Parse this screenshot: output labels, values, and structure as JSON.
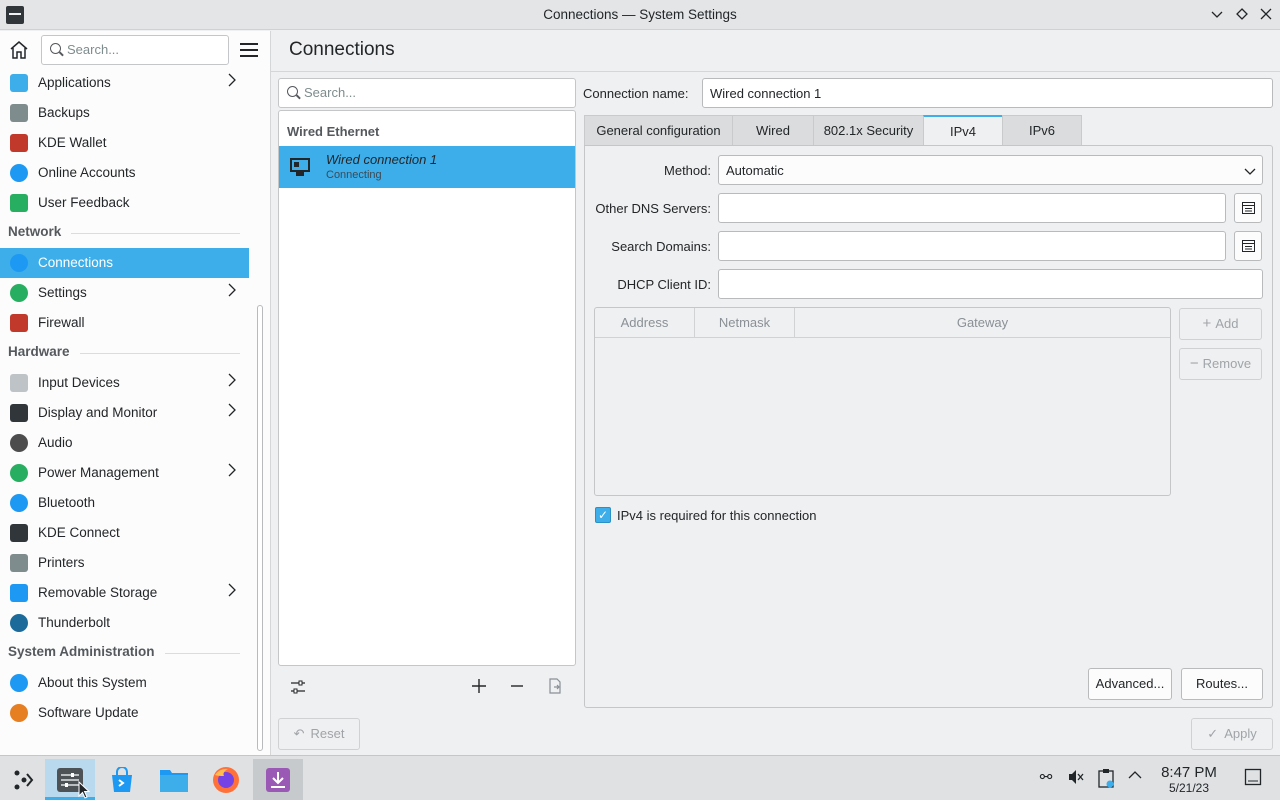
{
  "window": {
    "title": "Connections — System Settings"
  },
  "sidebar": {
    "search_placeholder": "Search...",
    "items": [
      {
        "label": "Applications",
        "chevron": true,
        "icon": "applications-icon",
        "color": "#3daee9"
      },
      {
        "label": "Backups",
        "chevron": false,
        "icon": "backups-icon",
        "color": "#7f8c8d"
      },
      {
        "label": "KDE Wallet",
        "chevron": false,
        "icon": "kde-wallet-icon",
        "color": "#c0392b"
      },
      {
        "label": "Online Accounts",
        "chevron": false,
        "icon": "online-accounts-icon",
        "color": "#1d99f3"
      },
      {
        "label": "User Feedback",
        "chevron": false,
        "icon": "user-feedback-icon",
        "color": "#27ae60"
      }
    ],
    "sections": [
      {
        "title": "Network",
        "items": [
          {
            "label": "Connections",
            "chevron": false,
            "active": true,
            "icon": "globe-network-icon",
            "color": "#1d99f3"
          },
          {
            "label": "Settings",
            "chevron": true,
            "icon": "network-settings-icon",
            "color": "#27ae60"
          },
          {
            "label": "Firewall",
            "chevron": false,
            "icon": "firewall-icon",
            "color": "#c0392b"
          }
        ]
      },
      {
        "title": "Hardware",
        "items": [
          {
            "label": "Input Devices",
            "chevron": true,
            "icon": "mouse-icon",
            "color": "#bdc3c7"
          },
          {
            "label": "Display and Monitor",
            "chevron": true,
            "icon": "monitor-icon",
            "color": "#31363b"
          },
          {
            "label": "Audio",
            "chevron": false,
            "icon": "speaker-icon",
            "color": "#4d4d4d"
          },
          {
            "label": "Power Management",
            "chevron": true,
            "icon": "power-icon",
            "color": "#27ae60"
          },
          {
            "label": "Bluetooth",
            "chevron": false,
            "icon": "bluetooth-icon",
            "color": "#1d99f3"
          },
          {
            "label": "KDE Connect",
            "chevron": false,
            "icon": "phone-icon",
            "color": "#31363b"
          },
          {
            "label": "Printers",
            "chevron": false,
            "icon": "printer-icon",
            "color": "#7f8c8d"
          },
          {
            "label": "Removable Storage",
            "chevron": true,
            "icon": "usb-storage-icon",
            "color": "#1d99f3"
          },
          {
            "label": "Thunderbolt",
            "chevron": false,
            "icon": "thunderbolt-icon",
            "color": "#1b6a9a"
          }
        ]
      },
      {
        "title": "System Administration",
        "items": [
          {
            "label": "About this System",
            "chevron": false,
            "icon": "info-icon",
            "color": "#1d99f3"
          },
          {
            "label": "Software Update",
            "chevron": false,
            "icon": "software-update-icon",
            "color": "#e67e22"
          }
        ]
      }
    ]
  },
  "page": {
    "title": "Connections"
  },
  "connections": {
    "search_placeholder": "Search...",
    "section": "Wired Ethernet",
    "items": [
      {
        "name": "Wired connection 1",
        "status": "Connecting"
      }
    ]
  },
  "form": {
    "connection_name_label": "Connection name:",
    "connection_name_value": "Wired connection 1",
    "tabs": [
      "General configuration",
      "Wired",
      "802.1x Security",
      "IPv4",
      "IPv6"
    ],
    "active_tab": "IPv4",
    "method_label": "Method:",
    "method_value": "Automatic",
    "dns_label": "Other DNS Servers:",
    "search_domains_label": "Search Domains:",
    "dhcp_label": "DHCP Client ID:",
    "table_headers": [
      "Address",
      "Netmask",
      "Gateway"
    ],
    "add_label": "Add",
    "remove_label": "Remove",
    "required_label": "IPv4 is required for this connection",
    "required_checked": true,
    "advanced_label": "Advanced...",
    "routes_label": "Routes..."
  },
  "footer": {
    "reset_label": "Reset",
    "apply_label": "Apply"
  },
  "taskbar": {
    "time": "8:47 PM",
    "date": "5/21/23"
  },
  "colors": {
    "accent": "#3daee9",
    "background": "#eff0f1"
  }
}
